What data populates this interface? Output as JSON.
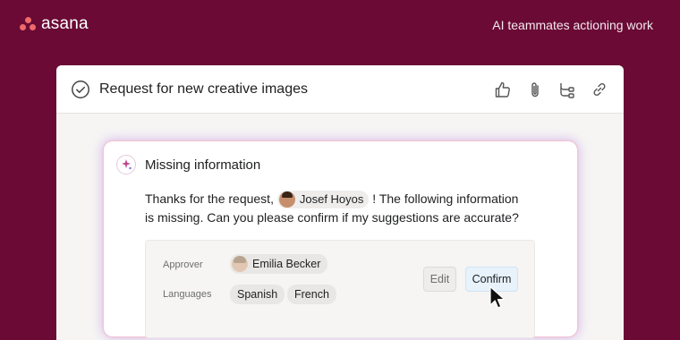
{
  "brand": {
    "name": "asana",
    "tagline": "AI teammates actioning work"
  },
  "task": {
    "title": "Request for new creative images"
  },
  "ai_panel": {
    "title": "Missing information",
    "message_before": "Thanks for the request, ",
    "mention_name": "Josef Hoyos",
    "message_after": " ! The following information is missing. Can you please confirm if my suggestions are accurate?",
    "approver_label": "Approver",
    "approver_value": "Emilia Becker",
    "languages_label": "Languages",
    "languages": [
      "Spanish",
      "French"
    ],
    "edit_label": "Edit",
    "confirm_label": "Confirm"
  },
  "colors": {
    "background": "#6a0a35",
    "brand_dots": "#f06a6a",
    "confirm_bg": "#e7f2fb"
  }
}
